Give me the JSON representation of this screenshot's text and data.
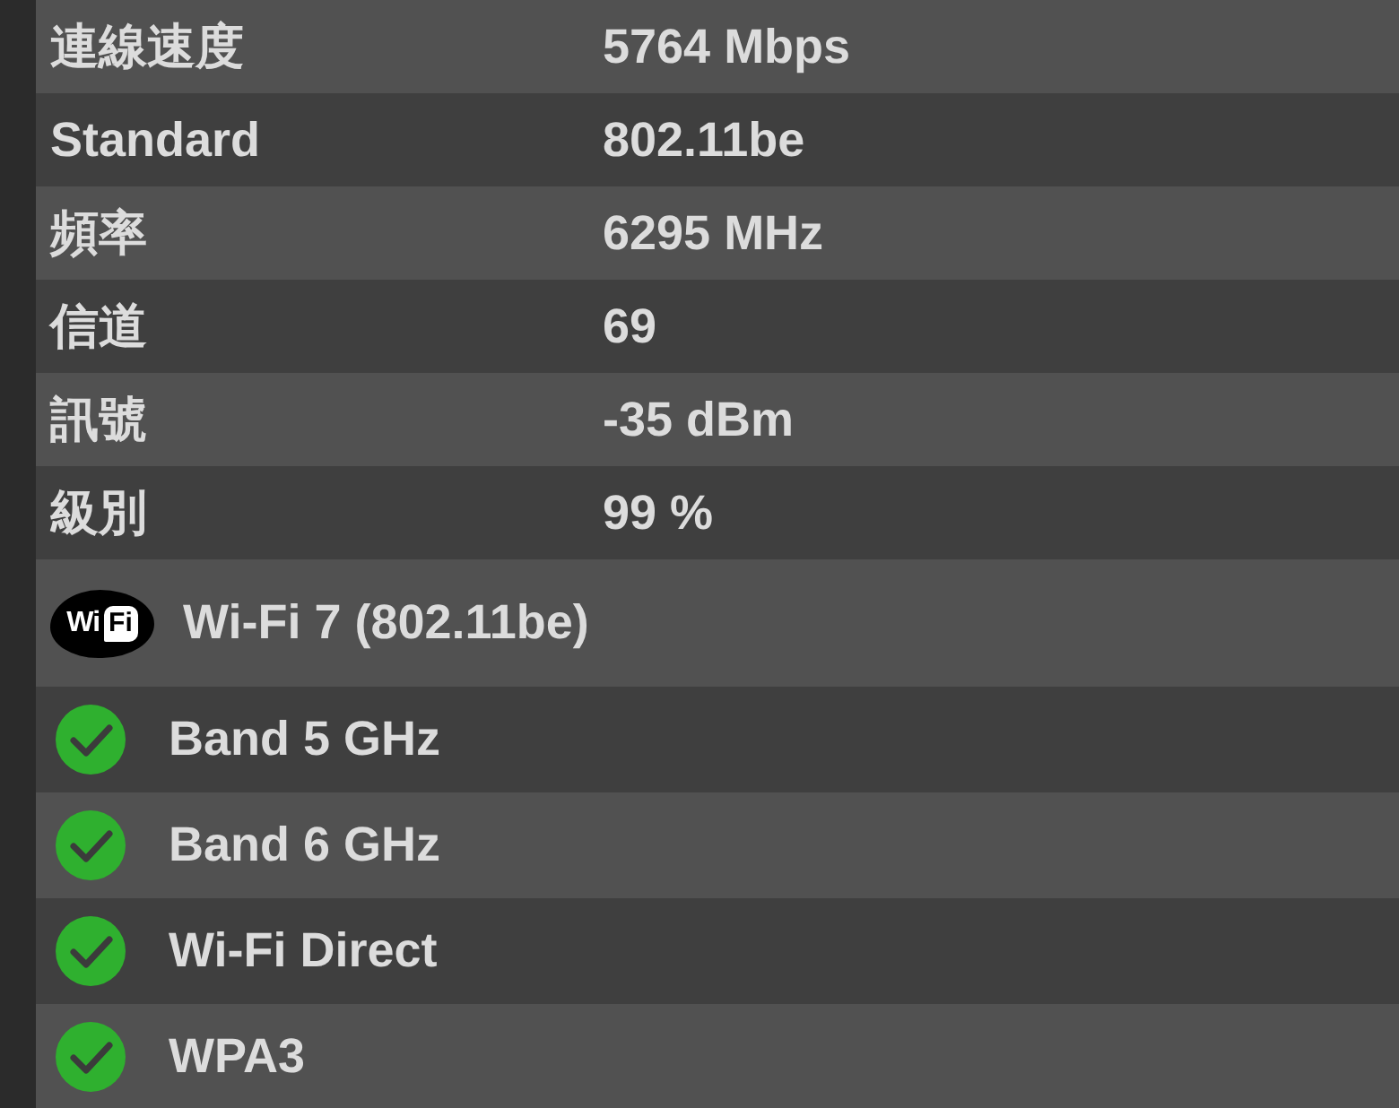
{
  "details": [
    {
      "label": "連線速度",
      "value": "5764 Mbps"
    },
    {
      "label": "Standard",
      "value": "802.11be"
    },
    {
      "label": "頻率",
      "value": "6295 MHz"
    },
    {
      "label": "信道",
      "value": "69"
    },
    {
      "label": "訊號",
      "value": "-35 dBm"
    },
    {
      "label": "級別",
      "value": "99 %"
    }
  ],
  "wifi_generation": {
    "logo": {
      "left": "Wi",
      "boxed": "Fi"
    },
    "label": "Wi-Fi 7 (802.11be)"
  },
  "features": [
    {
      "label": "Band 5 GHz",
      "supported": true
    },
    {
      "label": "Band 6 GHz",
      "supported": true
    },
    {
      "label": "Wi-Fi Direct",
      "supported": true
    },
    {
      "label": "WPA3",
      "supported": true
    }
  ]
}
